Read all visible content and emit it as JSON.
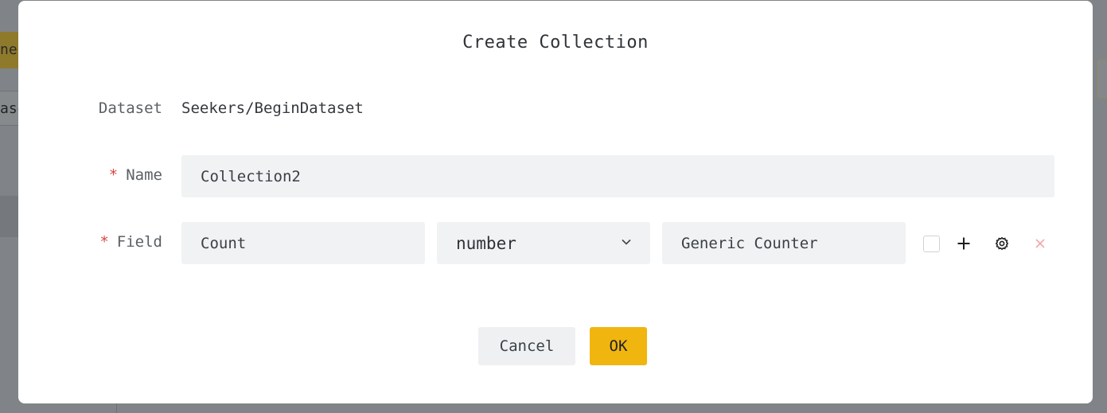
{
  "background": {
    "tab_yellow_text": "nes",
    "tab_text": "aset"
  },
  "dialog": {
    "title": "Create Collection",
    "dataset_label": "Dataset",
    "dataset_value": "Seekers/BeginDataset",
    "name_label": "Name",
    "name_value": "Collection2",
    "field_label": "Field",
    "required_mark": "*",
    "field_name_value": "Count",
    "field_type_value": "number",
    "field_description_value": "Generic Counter",
    "cancel_label": "Cancel",
    "ok_label": "OK"
  },
  "icons": {
    "checkbox": "checkbox-icon",
    "add": "plus-icon",
    "settings": "gear-icon",
    "remove": "close-icon",
    "dropdown": "chevron-down-icon"
  },
  "colors": {
    "accent": "#f0b50e",
    "required": "#d64545",
    "remove": "#f0a8a8",
    "input_bg": "#f1f2f4"
  }
}
